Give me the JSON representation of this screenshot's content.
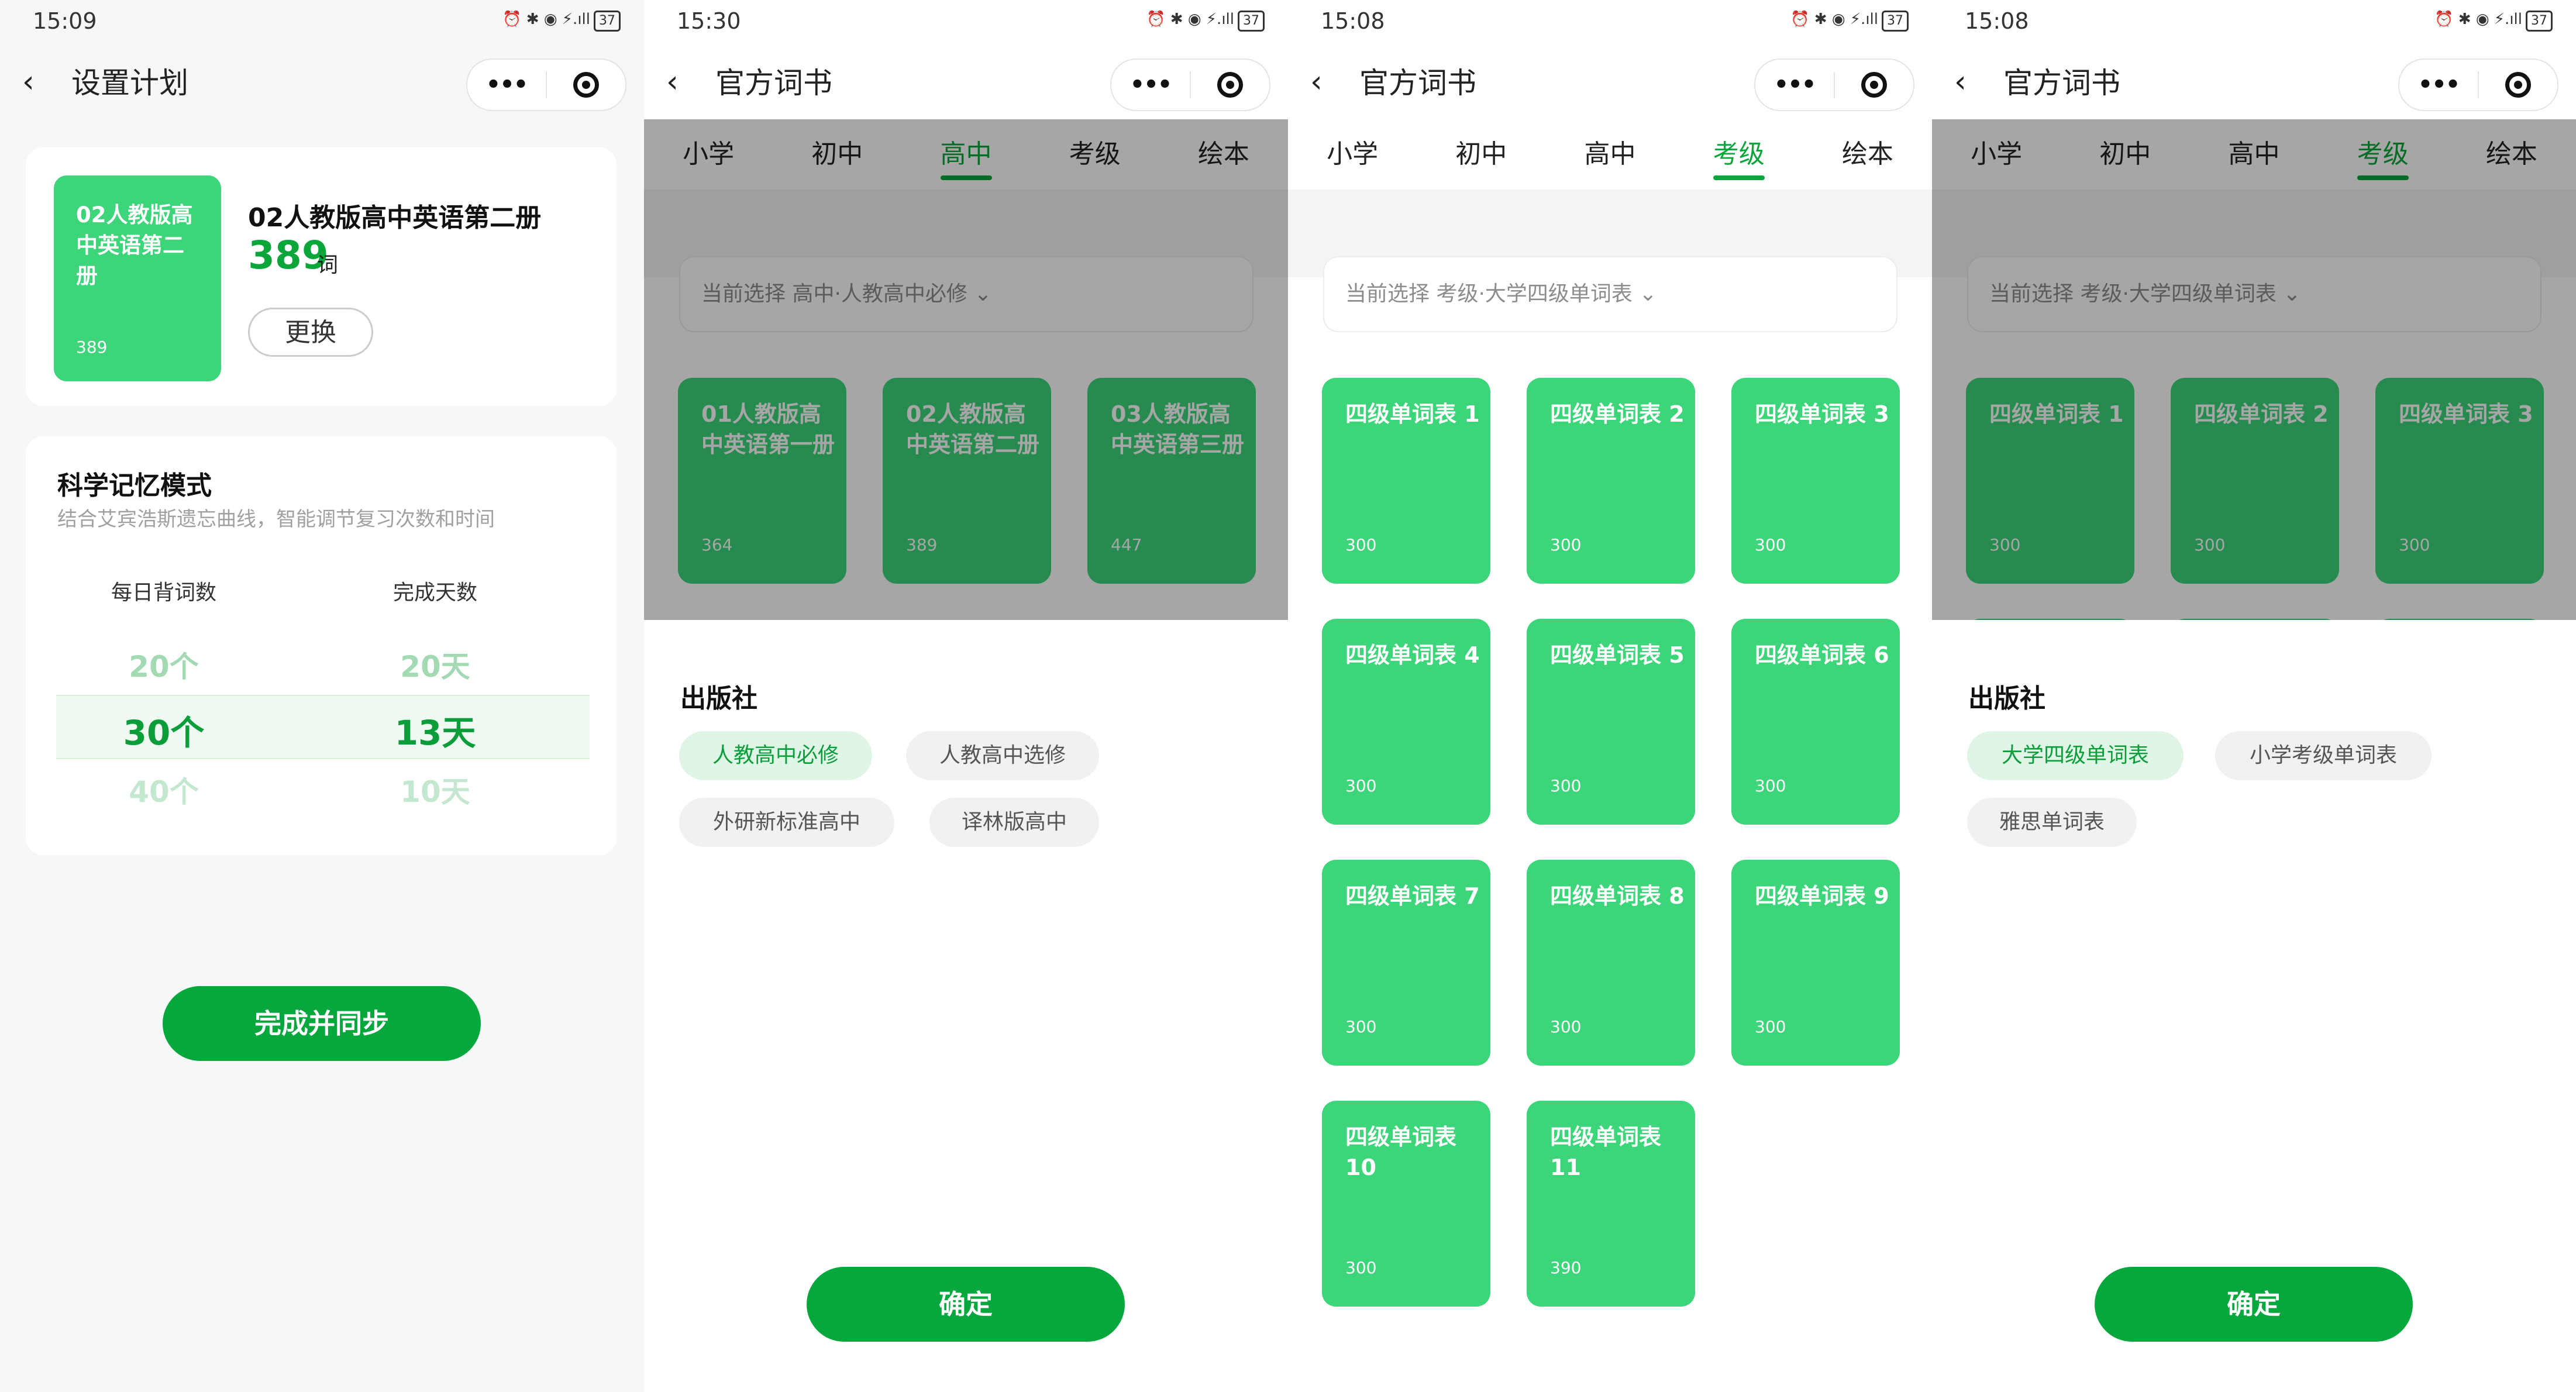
{
  "screen1": {
    "status": {
      "time": "15:09",
      "icons": "⏰ ✱ ◉ ⚡.ıll",
      "battery": "37"
    },
    "title": "设置计划",
    "book": {
      "cover_title": "02人教版高中英语第二册",
      "cover_count": "389",
      "title": "02人教版高中英语第二册",
      "count": "389",
      "count_unit": "词",
      "change_label": "更换"
    },
    "memory": {
      "title": "科学记忆模式",
      "desc": "结合艾宾浩斯遗忘曲线，智能调节复习次数和时间",
      "col1_label": "每日背词数",
      "col2_label": "完成天数",
      "col1_values": [
        "20个",
        "30个",
        "40个"
      ],
      "col2_values": [
        "20天",
        "13天",
        "10天"
      ]
    },
    "sync_label": "完成并同步"
  },
  "screen2": {
    "status": {
      "time": "15:30",
      "icons": "⏰ ✱ ◉ ⚡.ıll",
      "battery": "37"
    },
    "title": "官方词书",
    "tabs": [
      "小学",
      "初中",
      "高中",
      "考级",
      "绘本"
    ],
    "current": "当前选择 高中·人教高中必修 ⌄",
    "books": [
      {
        "title": "01人教版高中英语第一册",
        "count": "364"
      },
      {
        "title": "02人教版高中英语第二册",
        "count": "389"
      },
      {
        "title": "03人教版高中英语第三册",
        "count": "447"
      }
    ],
    "publisher_title": "出版社",
    "publishers": [
      "人教高中必修",
      "人教高中选修",
      "外研新标准高中",
      "译林版高中"
    ],
    "confirm_label": "确定"
  },
  "screen3": {
    "status": {
      "time": "15:08",
      "icons": "⏰ ✱ ◉ ⚡.ıll",
      "battery": "37"
    },
    "title": "官方词书",
    "tabs": [
      "小学",
      "初中",
      "高中",
      "考级",
      "绘本"
    ],
    "current": "当前选择 考级·大学四级单词表 ⌄",
    "books": [
      {
        "title": "四级单词表 1",
        "count": "300"
      },
      {
        "title": "四级单词表 2",
        "count": "300"
      },
      {
        "title": "四级单词表 3",
        "count": "300"
      },
      {
        "title": "四级单词表 4",
        "count": "300"
      },
      {
        "title": "四级单词表 5",
        "count": "300"
      },
      {
        "title": "四级单词表 6",
        "count": "300"
      },
      {
        "title": "四级单词表 7",
        "count": "300"
      },
      {
        "title": "四级单词表 8",
        "count": "300"
      },
      {
        "title": "四级单词表 9",
        "count": "300"
      },
      {
        "title": "四级单词表 10",
        "count": "300"
      },
      {
        "title": "四级单词表 11",
        "count": "390"
      }
    ]
  },
  "screen4": {
    "status": {
      "time": "15:08",
      "icons": "⏰ ✱ ◉ ⚡.ıll",
      "battery": "37"
    },
    "title": "官方词书",
    "tabs": [
      "小学",
      "初中",
      "高中",
      "考级",
      "绘本"
    ],
    "current": "当前选择 考级·大学四级单词表 ⌄",
    "books": [
      {
        "title": "四级单词表 1",
        "count": "300"
      },
      {
        "title": "四级单词表 2",
        "count": "300"
      },
      {
        "title": "四级单词表 3",
        "count": "300"
      }
    ],
    "publisher_title": "出版社",
    "publishers": [
      "大学四级单词表",
      "小学考级单词表",
      "雅思单词表"
    ],
    "confirm_label": "确定"
  },
  "colors": {
    "accent": "#06a73c",
    "tile": "#3dd57a",
    "overlay": "rgba(0,0,0,0.35)"
  },
  "icons": {
    "back": "chevron-left-icon",
    "more": "more-dots-icon",
    "target": "target-icon",
    "dropdown": "chevron-down-icon"
  }
}
